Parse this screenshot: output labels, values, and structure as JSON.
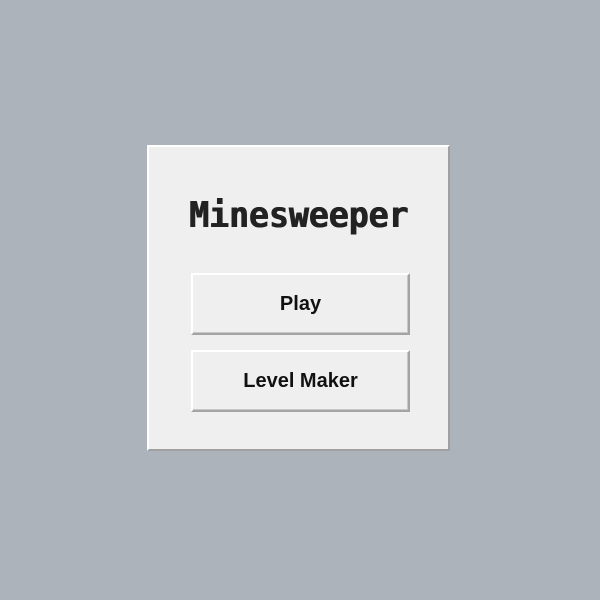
{
  "app": {
    "title": "Minesweeper"
  },
  "menu": {
    "play_label": "Play",
    "level_maker_label": "Level Maker"
  },
  "colors": {
    "background": "#adb3ba",
    "panel": "#efefef",
    "text": "#111111"
  }
}
